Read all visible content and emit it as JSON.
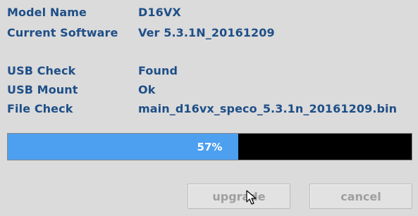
{
  "info": {
    "model_name_label": "Model Name",
    "model_name_value": "D16VX",
    "current_software_label": "Current Software",
    "current_software_value": "Ver 5.3.1N_20161209",
    "usb_check_label": "USB Check",
    "usb_check_value": "Found",
    "usb_mount_label": "USB Mount",
    "usb_mount_value": "Ok",
    "file_check_label": "File Check",
    "file_check_value": "main_d16vx_speco_5.3.1n_20161209.bin"
  },
  "progress": {
    "percent": 57,
    "text": "57%",
    "fill_color": "#4d9fef"
  },
  "buttons": {
    "upgrade_label": "upgrade",
    "cancel_label": "cancel"
  },
  "cursor": {
    "icon": "mouse-pointer-icon"
  },
  "colors": {
    "label_text": "#1f4f87",
    "background": "#dbdbdb",
    "disabled_button_text": "#9f9f9f"
  }
}
